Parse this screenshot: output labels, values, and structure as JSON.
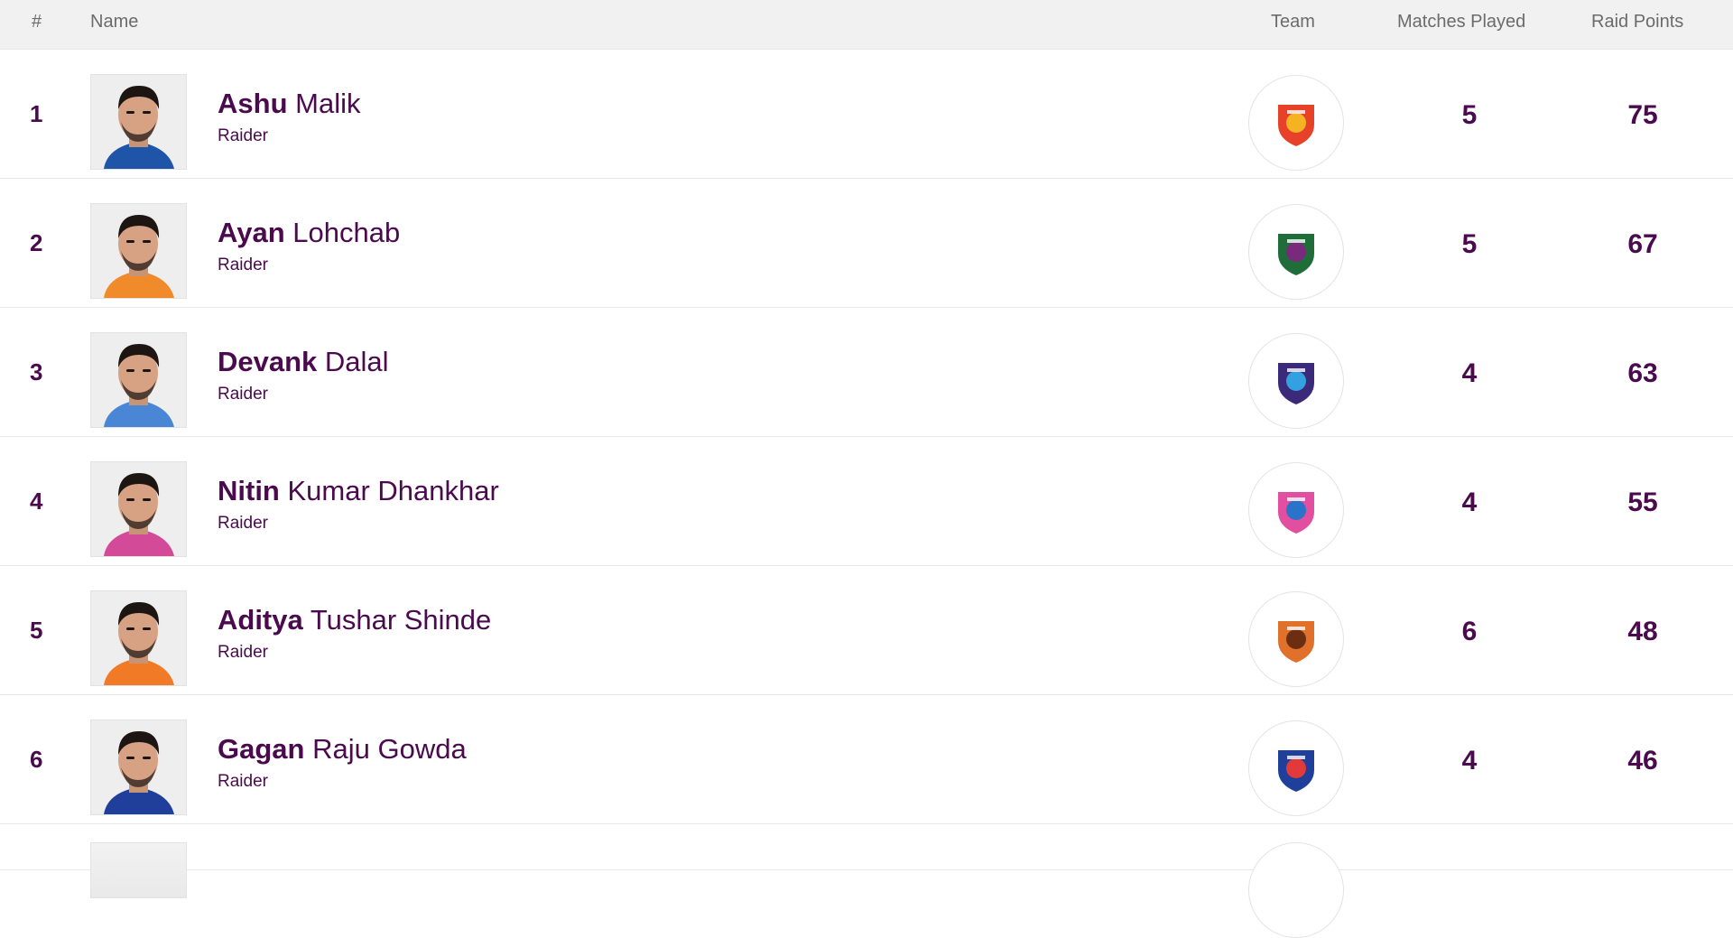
{
  "header": {
    "rank": "#",
    "name": "Name",
    "team": "Team",
    "matches_played": "Matches Played",
    "raid_points": "Raid Points"
  },
  "players": [
    {
      "rank": "1",
      "first": "Ashu",
      "last": "Malik",
      "role": "Raider",
      "matches": "5",
      "points": "75",
      "team_colors": [
        "#e8412a",
        "#f4b323"
      ],
      "jersey": "#1f55a8"
    },
    {
      "rank": "2",
      "first": "Ayan",
      "last": "Lohchab",
      "role": "Raider",
      "matches": "5",
      "points": "67",
      "team_colors": [
        "#1f6e3a",
        "#7a2a7c"
      ],
      "jersey": "#f08a2a"
    },
    {
      "rank": "3",
      "first": "Devank",
      "last": "Dalal",
      "role": "Raider",
      "matches": "4",
      "points": "63",
      "team_colors": [
        "#3b2a7a",
        "#33a0e0"
      ],
      "jersey": "#4a86d6"
    },
    {
      "rank": "4",
      "first": "Nitin",
      "last": "Kumar Dhankhar",
      "role": "Raider",
      "matches": "4",
      "points": "55",
      "team_colors": [
        "#e24fa0",
        "#2a73c9"
      ],
      "jersey": "#d34a98"
    },
    {
      "rank": "5",
      "first": "Aditya",
      "last": "Tushar Shinde",
      "role": "Raider",
      "matches": "6",
      "points": "48",
      "team_colors": [
        "#e0702a",
        "#6b2e12"
      ],
      "jersey": "#f07a25"
    },
    {
      "rank": "6",
      "first": "Gagan",
      "last": "Raju Gowda",
      "role": "Raider",
      "matches": "4",
      "points": "46",
      "team_colors": [
        "#1f3f9a",
        "#e23a3a"
      ],
      "jersey": "#1f3f9a"
    }
  ],
  "colors": {
    "text_primary": "#4a0a4d",
    "header_bg": "#f1f1f1",
    "header_text": "#6b6b6b"
  }
}
